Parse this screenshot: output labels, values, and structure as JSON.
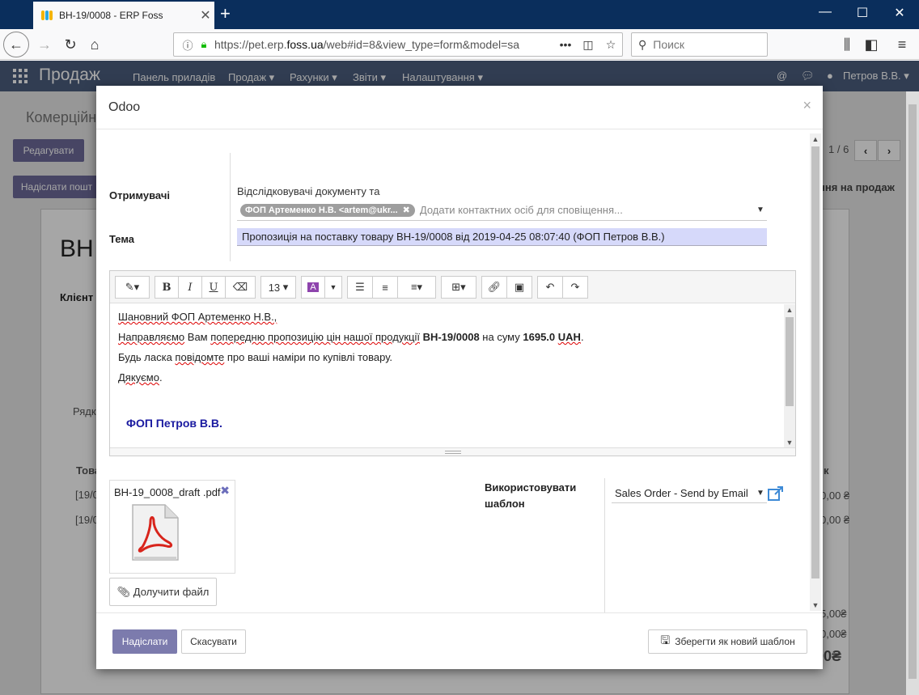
{
  "browser": {
    "tab_title": "ВН-19/0008 - ERP Foss",
    "url_prefix": "https://pet.erp.",
    "url_domain": "foss.ua",
    "url_rest": "/web#id=8&view_type=form&model=sa",
    "search_placeholder": "Поиск"
  },
  "odoo_nav": {
    "app_name": "Продаж",
    "menus": [
      "Панель приладів",
      "Продаж ▾",
      "Рахунки ▾",
      "Звіти ▾",
      "Налаштування ▾"
    ],
    "user": "Петров В.В. ▾"
  },
  "background": {
    "breadcrumb": "Комерційн",
    "edit_button": "Редагувати",
    "send_button": "Надіслати пошт",
    "pager": "1 / 6",
    "right_action": "ння на продаж",
    "doc_title": "ВН",
    "client_label": "Клієнт",
    "tab_label": "Рядк",
    "table_header": "Това",
    "row1": "[19/0",
    "row2": "[19/0",
    "col_k": "к",
    "amount1": "0,00 ₴",
    "amount2": "0,00 ₴",
    "total1": "5,00₴",
    "total2": "0,00₴",
    "total3": "00₴"
  },
  "modal": {
    "title": "Odoo",
    "close": "×",
    "recipients_label": "Отримувачі",
    "recipients_text": "Відслідковувачі документу та",
    "recipient_tag": "ФОП Артеменко Н.В. <artem@ukr...",
    "recipients_placeholder": "Додати контактних осіб для сповіщення...",
    "subject_label": "Тема",
    "subject_value": "Пропозиція на поставку товару ВН-19/0008 від 2019-04-25 08:07:40 (ФОП Петров В.В.)",
    "font_size": "13",
    "body": {
      "greeting": "Шановний ФОП Артеменко Н.В.,",
      "line1_a": "Направляємо",
      "line1_b": " Вам ",
      "line1_c": "попередню пропозицію цін нашої продукції",
      "line1_d": "ВН-19/0008",
      "line1_e": " на суму ",
      "line1_f": "1695.0",
      "line1_g": "UAH",
      "line2_a": "Будь ласка ",
      "line2_b": "повідомте",
      "line2_c": " про ваші наміри по купівлі товару.",
      "thanks": "Дякуємо",
      "signature": "ФОП Петров В.В."
    },
    "attachment_name": "ВН-19_0008_draft .pdf",
    "attach_button": "Долучити файл",
    "template_label": "Використовувати шаблон",
    "template_value": "Sales Order - Send by Email",
    "send_button": "Надіслати",
    "cancel_button": "Скасувати",
    "save_template_button": "Зберегти як новий шаблон"
  }
}
